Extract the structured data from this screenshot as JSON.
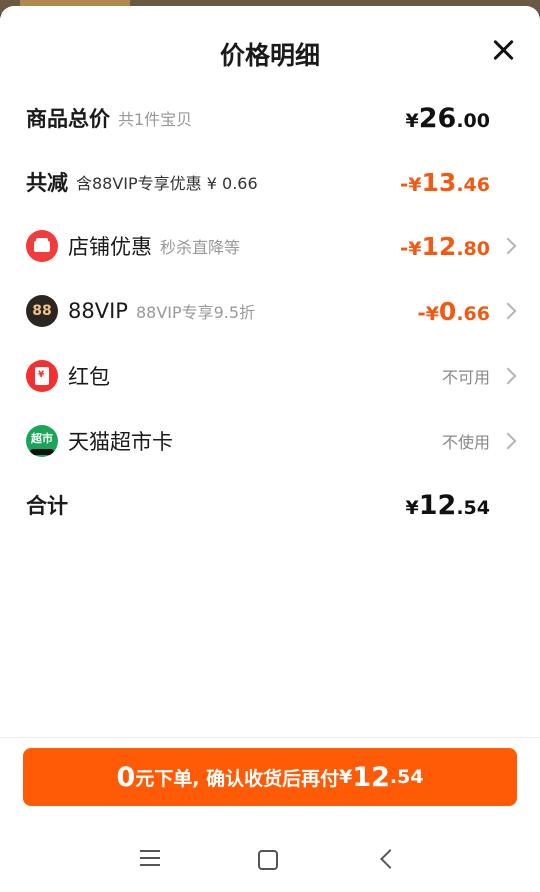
{
  "sheet": {
    "title": "价格明细"
  },
  "rows": {
    "total": {
      "label": "商品总价",
      "sub": "共1件宝贝",
      "currency": "¥",
      "int": "26",
      "dec": ".00"
    },
    "discount": {
      "label": "共减",
      "sub": "含88VIP专享优惠 ¥ 0.66",
      "minus": "-",
      "currency": "¥",
      "int": "13",
      "dec": ".46"
    },
    "shop_coupon": {
      "icon": "shop-icon",
      "label": "店铺优惠",
      "sub": "秒杀直降等",
      "minus": "-",
      "currency": "¥",
      "int": "12",
      "dec": ".80"
    },
    "vip": {
      "icon_text": "88",
      "label": "88VIP",
      "sub": "88VIP专享9.5折",
      "minus": "-",
      "currency": "¥",
      "int": "0",
      "dec": ".66"
    },
    "red_packet": {
      "icon": "red-packet-icon",
      "label": "红包",
      "status": "不可用"
    },
    "market_card": {
      "icon_text": "超市",
      "label": "天猫超市卡",
      "status": "不使用"
    },
    "sum": {
      "label": "合计",
      "currency": "¥",
      "int": "12",
      "dec": ".54"
    }
  },
  "cta": {
    "big": "0",
    "text": "元下单, 确认收货后再付 ",
    "currency": "¥",
    "int": "12",
    "dec": ".54"
  },
  "colors": {
    "accent": "#ff5a06",
    "discount_text": "#f25a13"
  }
}
